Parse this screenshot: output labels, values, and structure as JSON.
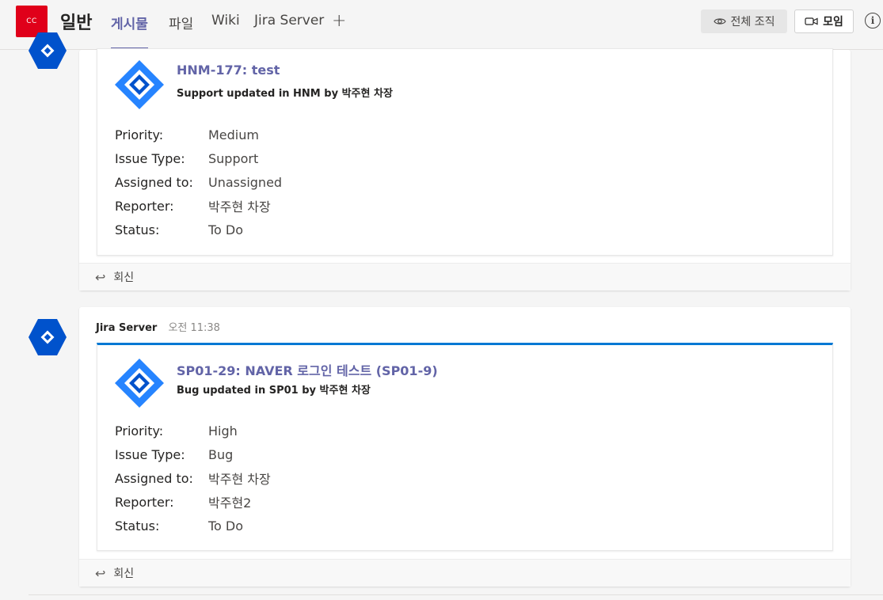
{
  "header": {
    "team_initials": "CC",
    "channel_name": "일반",
    "tabs": [
      "게시물",
      "파일",
      "Wiki",
      "Jira Server"
    ],
    "add_tab_glyph": "+",
    "org_button_label": "전체 조직",
    "meet_button_label": "모임",
    "info_glyph": "i"
  },
  "posts": [
    {
      "card": {
        "title": "HNM-177: test",
        "subtitle": "Support updated in HNM by 박주현 차장",
        "fields": [
          {
            "label": "Priority:",
            "value": "Medium"
          },
          {
            "label": "Issue Type:",
            "value": "Support"
          },
          {
            "label": "Assigned to:",
            "value": "Unassigned"
          },
          {
            "label": "Reporter:",
            "value": "박주현 차장"
          },
          {
            "label": "Status:",
            "value": "To Do"
          }
        ]
      },
      "reply_label": "회신"
    },
    {
      "author": "Jira Server",
      "time": "오전 11:38",
      "card": {
        "title": "SP01-29: NAVER 로그인 테스트 (SP01-9)",
        "subtitle": "Bug updated in SP01 by 박주현 차장",
        "fields": [
          {
            "label": "Priority:",
            "value": "High"
          },
          {
            "label": "Issue Type:",
            "value": "Bug"
          },
          {
            "label": "Assigned to:",
            "value": "박주현 차장"
          },
          {
            "label": "Reporter:",
            "value": "박주현2"
          },
          {
            "label": "Status:",
            "value": "To Do"
          }
        ]
      },
      "reply_label": "회신"
    }
  ],
  "colors": {
    "accent": "#6264a7",
    "card_accent": "#0078d4",
    "jira_blue": "#2684ff",
    "bot_avatar": "#0052cc",
    "team_red": "#e0001a"
  },
  "icons": {
    "org_button": "eye-icon",
    "meet_button": "video-camera-icon",
    "reply": "reply-arrow-icon",
    "info": "info-icon",
    "add_tab": "plus-icon",
    "bot": "jira-server-bot-icon",
    "card_logo": "jira-logo-icon"
  }
}
